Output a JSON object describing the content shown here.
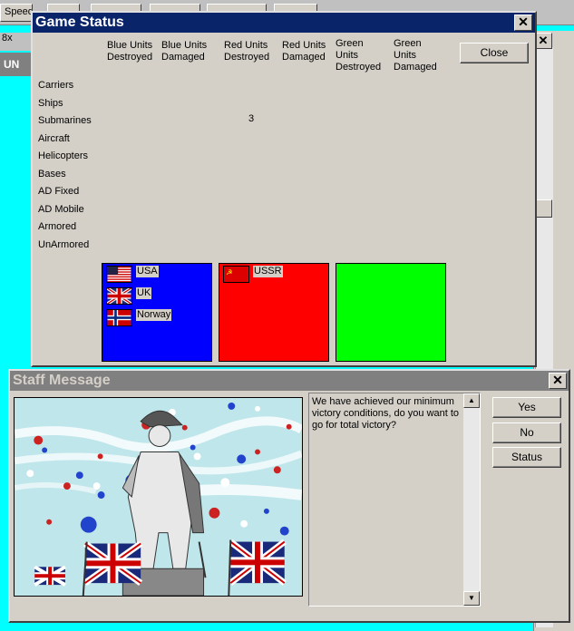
{
  "background": {
    "toolbar_items": [
      "Speed",
      "",
      "",
      "",
      "",
      "",
      ""
    ],
    "left_field": "8x",
    "left_label": "UN",
    "right_close": "✕"
  },
  "game_status": {
    "title": "Game Status",
    "close_glyph": "✕",
    "close_button": "Close",
    "columns": [
      "Blue Units\nDestroyed",
      "Blue Units\nDamaged",
      "Red Units\nDestroyed",
      "Red Units\nDamaged",
      "Green\nUnits\nDestroyed",
      "Green\nUnits\nDamaged"
    ],
    "rows": [
      "Carriers",
      "Ships",
      "Submarines",
      "Aircraft",
      "Helicopters",
      "Bases",
      "AD Fixed",
      "AD Mobile",
      "Armored",
      "UnArmored"
    ],
    "cells": [
      {
        "row": "Submarines",
        "column": "Red Units Destroyed",
        "value": "3"
      }
    ],
    "teams": {
      "blue": {
        "color": "#0000ff",
        "nations": [
          "USA",
          "UK",
          "Norway"
        ]
      },
      "red": {
        "color": "#ff0000",
        "nations": [
          "USSR"
        ]
      },
      "green": {
        "color": "#00ff00",
        "nations": []
      }
    }
  },
  "staff_message": {
    "title": "Staff Message",
    "close_glyph": "✕",
    "message": "We have achieved our minimum victory conditions, do you want to go for total victory?",
    "buttons": {
      "yes": "Yes",
      "no": "No",
      "status": "Status"
    },
    "picture_icon": "admiral-statue-with-flags-and-balloons"
  }
}
